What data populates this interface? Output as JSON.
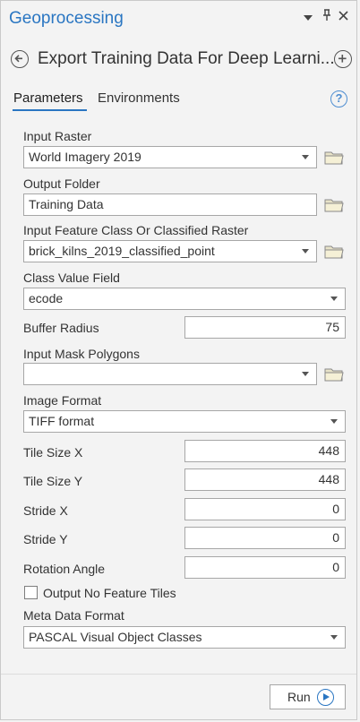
{
  "pane": {
    "title": "Geoprocessing",
    "icons": [
      "chevron-down-icon",
      "pin-icon",
      "close-icon"
    ]
  },
  "tool": {
    "title": "Export Training Data For Deep Learni..."
  },
  "tabs": [
    {
      "label": "Parameters",
      "active": true
    },
    {
      "label": "Environments",
      "active": false
    }
  ],
  "help_symbol": "?",
  "params": {
    "input_raster": {
      "label": "Input Raster",
      "value": "World Imagery 2019"
    },
    "output_folder": {
      "label": "Output Folder",
      "value": "Training Data"
    },
    "input_feature_class": {
      "label": "Input Feature Class Or Classified Raster",
      "value": "brick_kilns_2019_classified_point"
    },
    "class_value_field": {
      "label": "Class Value Field",
      "value": "ecode"
    },
    "buffer_radius": {
      "label": "Buffer Radius",
      "value": "75"
    },
    "input_mask_polygons": {
      "label": "Input Mask Polygons",
      "value": ""
    },
    "image_format": {
      "label": "Image Format",
      "value": "TIFF format"
    },
    "tile_size_x": {
      "label": "Tile Size X",
      "value": "448"
    },
    "tile_size_y": {
      "label": "Tile Size Y",
      "value": "448"
    },
    "stride_x": {
      "label": "Stride X",
      "value": "0"
    },
    "stride_y": {
      "label": "Stride Y",
      "value": "0"
    },
    "rotation_angle": {
      "label": "Rotation Angle",
      "value": "0"
    },
    "output_no_feature_tiles": {
      "label": "Output No Feature Tiles",
      "checked": false
    },
    "meta_data_format": {
      "label": "Meta Data Format",
      "value": "PASCAL Visual Object Classes"
    }
  },
  "run_button": {
    "label": "Run"
  },
  "colors": {
    "accent": "#2a76c2",
    "background": "#f3f3f3"
  }
}
